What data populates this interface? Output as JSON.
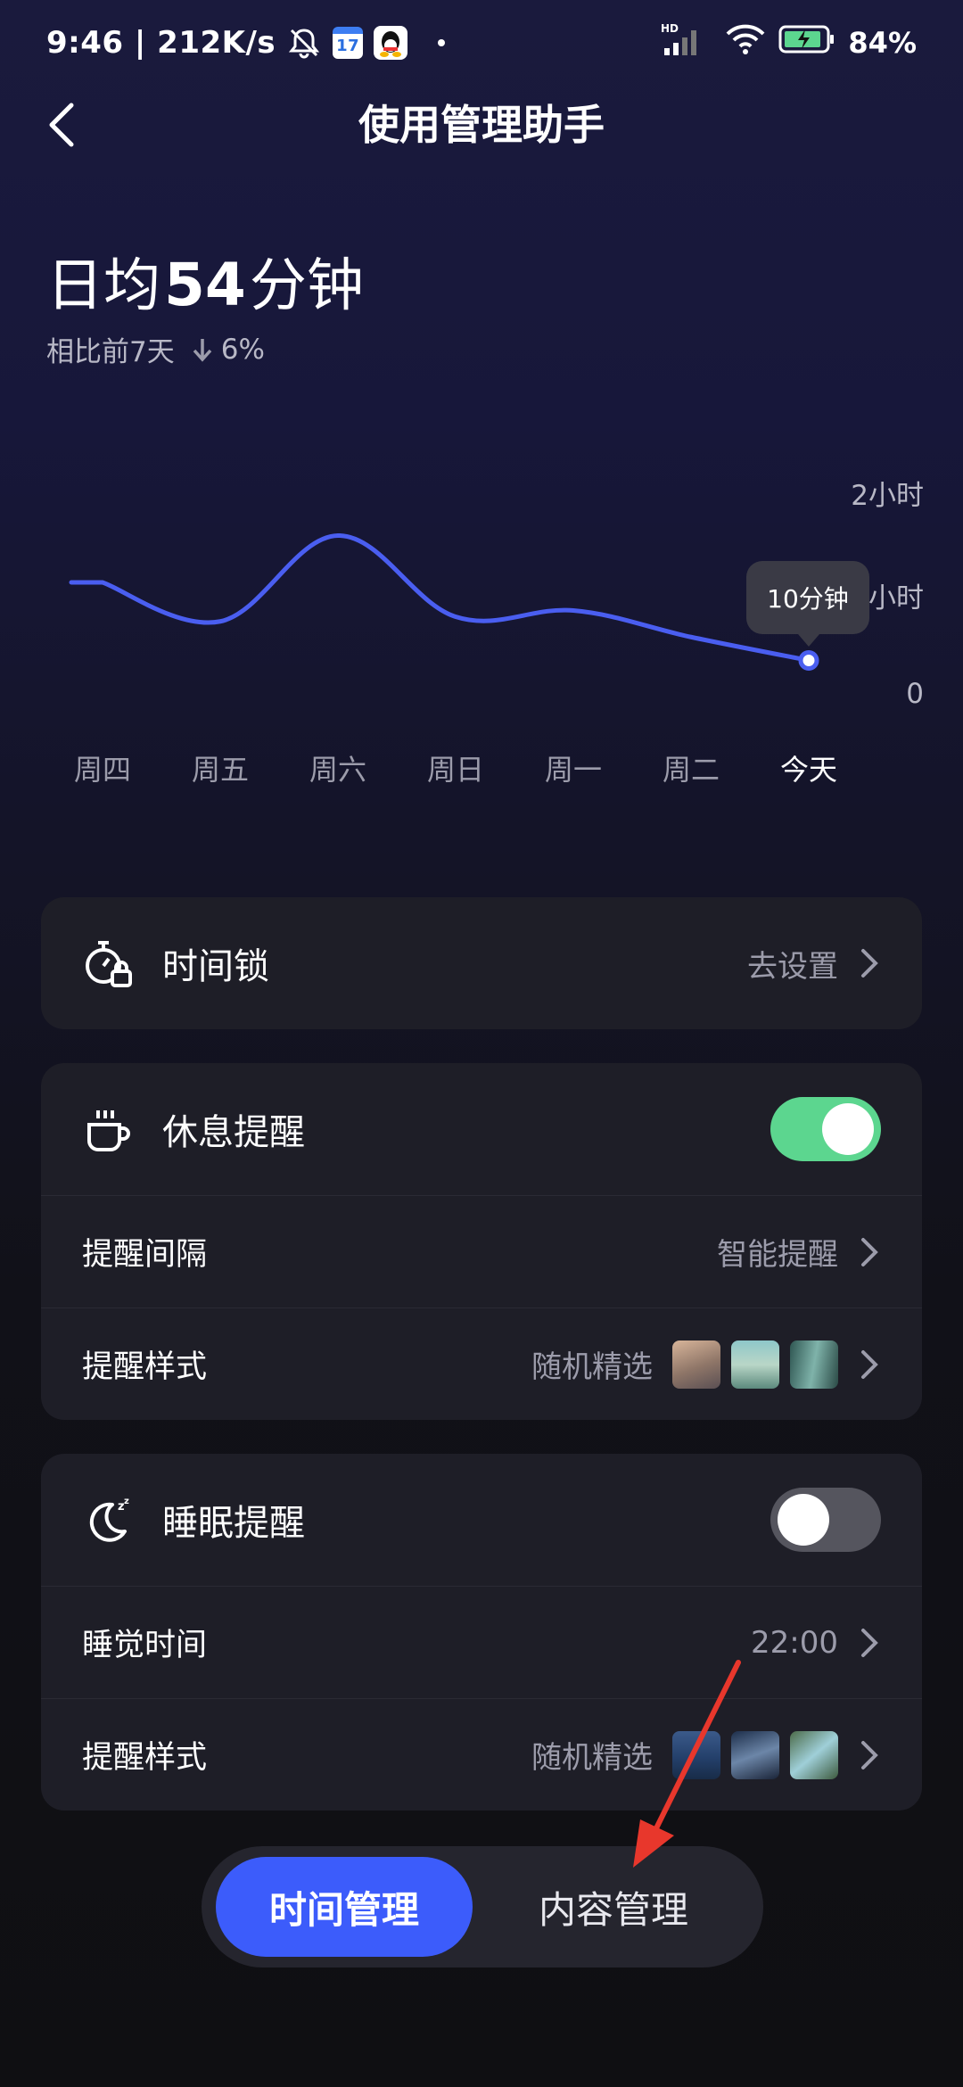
{
  "status_bar": {
    "time": "9:46",
    "network_speed": "212K/s",
    "calendar_day": "17",
    "hd_label": "HD",
    "battery": "84%"
  },
  "header": {
    "title": "使用管理助手"
  },
  "summary": {
    "avg_prefix": "日均",
    "avg_value": "54",
    "avg_unit": "分钟",
    "compare_label": "相比前7天",
    "compare_change": "6%"
  },
  "chart_data": {
    "type": "line",
    "categories": [
      "周四",
      "周五",
      "周六",
      "周日",
      "周一",
      "周二",
      "今天"
    ],
    "values": [
      60,
      35,
      90,
      38,
      42,
      25,
      10
    ],
    "unit": "分钟",
    "y_ticks": [
      "2小时",
      "1小时",
      "0"
    ],
    "ylim": [
      0,
      120
    ],
    "highlight_label": "10分钟",
    "color": "#4a5ef0"
  },
  "time_lock": {
    "title": "时间锁",
    "action": "去设置"
  },
  "rest_reminder": {
    "title": "休息提醒",
    "enabled": true,
    "interval_label": "提醒间隔",
    "interval_value": "智能提醒",
    "style_label": "提醒样式",
    "style_value": "随机精选"
  },
  "sleep_reminder": {
    "title": "睡眠提醒",
    "enabled": false,
    "time_label": "睡觉时间",
    "time_value": "22:00",
    "style_label": "提醒样式",
    "style_value": "随机精选"
  },
  "bottom_tabs": {
    "time_management": "时间管理",
    "content_management": "内容管理"
  },
  "colors": {
    "accent": "#3c5cfb",
    "toggle_on": "#5cd68f",
    "annotation_arrow": "#e8372c"
  }
}
